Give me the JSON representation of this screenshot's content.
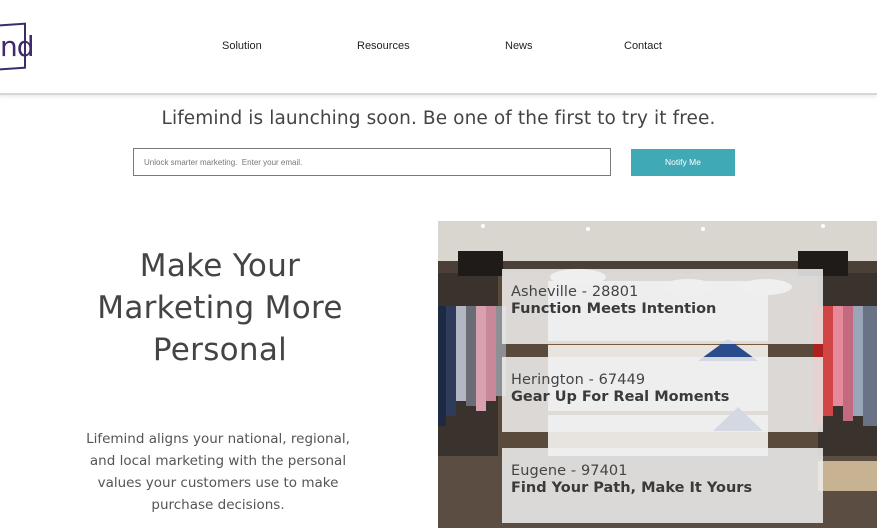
{
  "header": {
    "logo_text": "nd",
    "nav": [
      {
        "label": "Solution"
      },
      {
        "label": "Resources"
      },
      {
        "label": "News"
      },
      {
        "label": "Contact"
      }
    ]
  },
  "signup": {
    "tagline": "Lifemind is launching soon.  Be one of the first to try it free.",
    "email_placeholder": "Unlock smarter marketing.  Enter your email.",
    "email_value": "",
    "button_label": "Notify Me"
  },
  "hero": {
    "title_lines": [
      "Make Your",
      "Marketing More",
      "Personal"
    ],
    "body_lines": [
      "Lifemind aligns your national, regional,",
      "and local marketing with the personal",
      "values your customers use to make",
      "purchase decisions."
    ]
  },
  "cards": [
    {
      "location": "Asheville - 28801",
      "title": "Function Meets Intention"
    },
    {
      "location": "Herington - 67449",
      "title": "Gear Up For Real Moments"
    },
    {
      "location": "Eugene - 97401",
      "title": "Find Your Path, Make It Yours"
    }
  ],
  "colors": {
    "accent": "#3fa9b5",
    "logo": "#3d2b6b"
  }
}
